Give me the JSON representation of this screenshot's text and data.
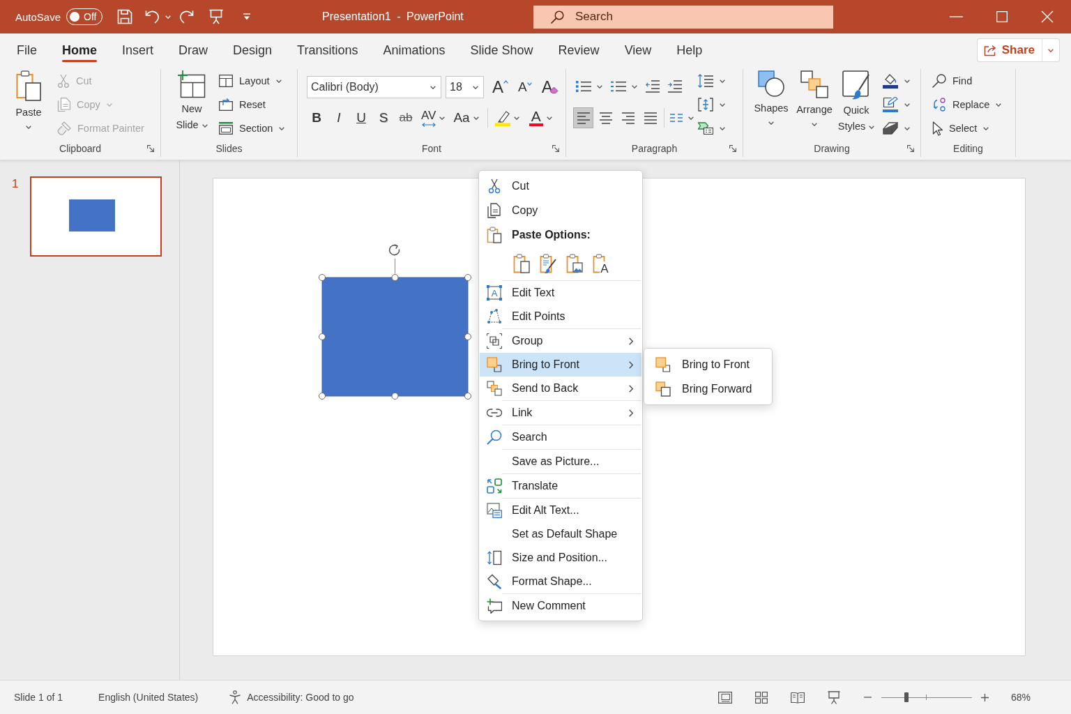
{
  "title_bar": {
    "autosave": {
      "label": "AutoSave",
      "state_text": "Off",
      "on": false
    },
    "title": "Presentation1 - PowerPoint",
    "search": {
      "placeholder": "Search"
    }
  },
  "tabs": [
    {
      "label": "File",
      "selected": false
    },
    {
      "label": "Home",
      "selected": true
    },
    {
      "label": "Insert",
      "selected": false
    },
    {
      "label": "Draw",
      "selected": false
    },
    {
      "label": "Design",
      "selected": false
    },
    {
      "label": "Transitions",
      "selected": false
    },
    {
      "label": "Animations",
      "selected": false
    },
    {
      "label": "Slide Show",
      "selected": false
    },
    {
      "label": "Review",
      "selected": false
    },
    {
      "label": "View",
      "selected": false
    },
    {
      "label": "Help",
      "selected": false
    }
  ],
  "share": {
    "label": "Share"
  },
  "ribbon": {
    "clipboard": {
      "label": "Clipboard",
      "launcher": true,
      "paste": "Paste",
      "commands": [
        {
          "label": "Cut",
          "disabled": true,
          "dropdown": false
        },
        {
          "label": "Copy",
          "disabled": true,
          "dropdown": true
        },
        {
          "label": "Format Painter",
          "disabled": true,
          "dropdown": false
        }
      ]
    },
    "slides": {
      "label": "Slides",
      "new_slide": "New Slide",
      "commands": [
        {
          "label": "Layout",
          "dropdown": true
        },
        {
          "label": "Reset",
          "dropdown": false
        },
        {
          "label": "Section",
          "dropdown": true
        }
      ]
    },
    "font": {
      "label": "Font",
      "launcher": true,
      "font_name": "Calibri (Body)",
      "font_size": "18",
      "grow_font": "A",
      "shrink_font": "A",
      "clear_formatting": "A",
      "format_buttons": [
        {
          "kind": "bold",
          "label": "B",
          "dropdown": false
        },
        {
          "kind": "italic",
          "label": "I",
          "dropdown": false
        },
        {
          "kind": "underline",
          "label": "U",
          "dropdown": false
        },
        {
          "kind": "shadow",
          "label": "S",
          "dropdown": false
        },
        {
          "kind": "strikethrough",
          "label": "ab",
          "dropdown": false
        },
        {
          "kind": "spacing",
          "label": "AV",
          "dropdown": true
        },
        {
          "kind": "case",
          "label": "Aa",
          "dropdown": true
        }
      ],
      "font_color": "A"
    },
    "paragraph": {
      "label": "Paragraph",
      "launcher": true,
      "alignment": [
        {
          "selected": true
        },
        {
          "selected": false
        },
        {
          "selected": false
        },
        {
          "selected": false
        }
      ]
    },
    "drawing": {
      "label": "Drawing",
      "launcher": true,
      "shapes": "Shapes",
      "arrange": "Arrange",
      "quick_styles": "Quick Styles"
    },
    "editing": {
      "label": "Editing",
      "commands": [
        {
          "label": "Find",
          "dropdown": false
        },
        {
          "label": "Replace",
          "dropdown": true
        },
        {
          "label": "Select",
          "dropdown": true
        }
      ]
    }
  },
  "thumbnails": [
    {
      "number": "1",
      "selected": true
    }
  ],
  "slide": {
    "shape": {
      "selected": true
    }
  },
  "context_menu": {
    "items": [
      {
        "kind": "command",
        "label": "Cut",
        "selected": false,
        "submenu": false,
        "separator_before": false
      },
      {
        "kind": "command",
        "label": "Copy",
        "selected": false,
        "submenu": false,
        "separator_before": false
      },
      {
        "kind": "heading",
        "label": "Paste Options:"
      },
      {
        "kind": "paste_row",
        "options": [
          {
            "kind": "keep_source"
          },
          {
            "kind": "destination_theme"
          },
          {
            "kind": "picture"
          },
          {
            "kind": "text_only",
            "icon_text": "A"
          }
        ]
      },
      {
        "kind": "command",
        "label": "Edit Text",
        "icon_text": "A",
        "selected": false,
        "submenu": false,
        "separator_before": true
      },
      {
        "kind": "command",
        "label": "Edit Points",
        "selected": false,
        "submenu": false,
        "separator_before": false
      },
      {
        "kind": "command",
        "label": "Group",
        "selected": false,
        "submenu": true,
        "separator_before": true
      },
      {
        "kind": "command",
        "label": "Bring to Front",
        "selected": true,
        "submenu": true,
        "separator_before": false
      },
      {
        "kind": "command",
        "label": "Send to Back",
        "selected": false,
        "submenu": true,
        "separator_before": false
      },
      {
        "kind": "command",
        "label": "Link",
        "selected": false,
        "submenu": true,
        "separator_before": true
      },
      {
        "kind": "command",
        "label": "Search",
        "selected": false,
        "submenu": false,
        "separator_before": true
      },
      {
        "kind": "command",
        "label": "Save as Picture...",
        "selected": false,
        "submenu": false,
        "separator_before": true
      },
      {
        "kind": "command",
        "label": "Translate",
        "selected": false,
        "submenu": false,
        "separator_before": true
      },
      {
        "kind": "command",
        "label": "Edit Alt Text...",
        "selected": false,
        "submenu": false,
        "separator_before": true
      },
      {
        "kind": "command",
        "label": "Set as Default Shape",
        "selected": false,
        "submenu": false,
        "separator_before": false
      },
      {
        "kind": "command",
        "label": "Size and Position...",
        "selected": false,
        "submenu": false,
        "separator_before": false
      },
      {
        "kind": "command",
        "label": "Format Shape...",
        "selected": false,
        "submenu": false,
        "separator_before": false
      },
      {
        "kind": "command",
        "label": "New Comment",
        "selected": false,
        "submenu": false,
        "separator_before": true
      }
    ]
  },
  "submenu": {
    "items": [
      {
        "label": "Bring to Front",
        "selected": false
      },
      {
        "label": "Bring Forward",
        "selected": false
      }
    ]
  },
  "status_bar": {
    "slide_info": "Slide 1 of 1",
    "language": "English (United States)",
    "accessibility": "Accessibility: Good to go",
    "zoom": {
      "level": 0.28,
      "reading": "68%"
    }
  }
}
